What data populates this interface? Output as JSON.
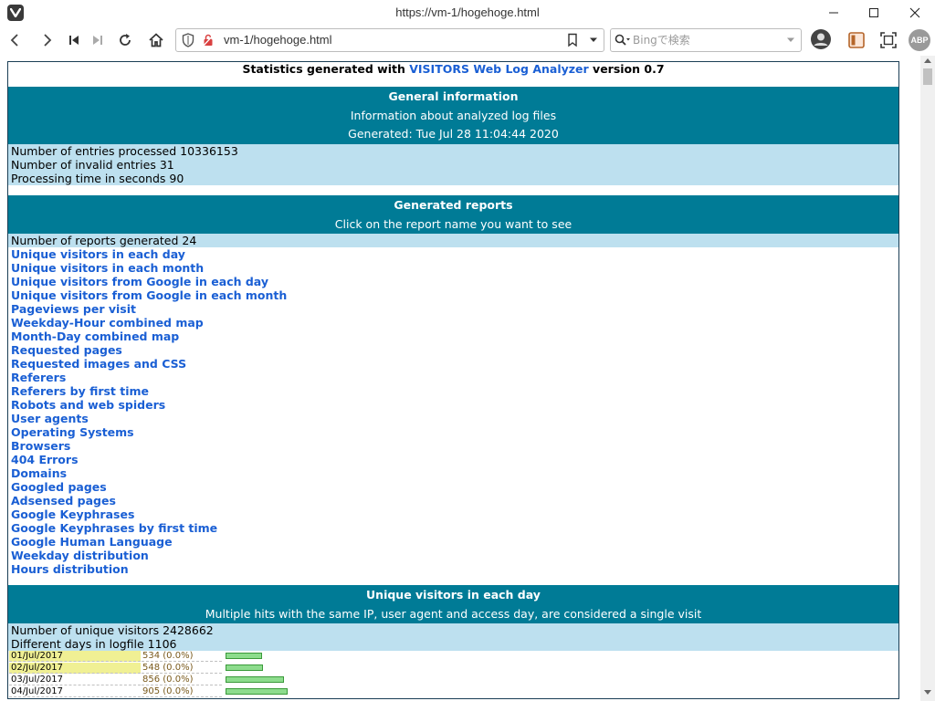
{
  "window": {
    "title": "https://vm-1/hogehoge.html"
  },
  "toolbar": {
    "url": "vm-1/hogehoge.html",
    "search_placeholder": "Bingで検索",
    "abp_label": "ABP"
  },
  "report": {
    "header_prefix": "Statistics generated with",
    "header_link": "VISITORS Web Log Analyzer",
    "header_suffix": "version 0.7",
    "general": {
      "title": "General information",
      "subtitle": "Information about analyzed log files",
      "generated": "Generated: Tue Jul 28 11:04:44 2020",
      "lines": [
        "Number of entries processed 10336153",
        "Number of invalid entries 31",
        "Processing time in seconds 90"
      ]
    },
    "reports": {
      "title": "Generated reports",
      "subtitle": "Click on the report name you want to see",
      "count_line": "Number of reports generated 24",
      "links": [
        "Unique visitors in each day",
        "Unique visitors in each month",
        "Unique visitors from Google in each day",
        "Unique visitors from Google in each month",
        "Pageviews per visit",
        "Weekday-Hour combined map",
        "Month-Day combined map",
        "Requested pages",
        "Requested images and CSS",
        "Referers",
        "Referers by first time",
        "Robots and web spiders",
        "User agents",
        "Operating Systems",
        "Browsers",
        "404 Errors",
        "Domains",
        "Googled pages",
        "Adsensed pages",
        "Google Keyphrases",
        "Google Keyphrases by first time",
        "Google Human Language",
        "Weekday distribution",
        "Hours distribution"
      ]
    },
    "unique_daily": {
      "title": "Unique visitors in each day",
      "subtitle": "Multiple hits with the same IP, user agent and access day, are considered a single visit",
      "lines": [
        "Number of unique visitors 2428662",
        "Different days in logfile 1106"
      ],
      "rows": [
        {
          "date": "01/Jul/2017",
          "count": "534 (0.0%)",
          "value": 534,
          "highlight": true
        },
        {
          "date": "02/Jul/2017",
          "count": "548 (0.0%)",
          "value": 548,
          "highlight": true
        },
        {
          "date": "03/Jul/2017",
          "count": "856 (0.0%)",
          "value": 856,
          "highlight": false
        },
        {
          "date": "04/Jul/2017",
          "count": "905 (0.0%)",
          "value": 905,
          "highlight": false
        }
      ]
    }
  }
}
